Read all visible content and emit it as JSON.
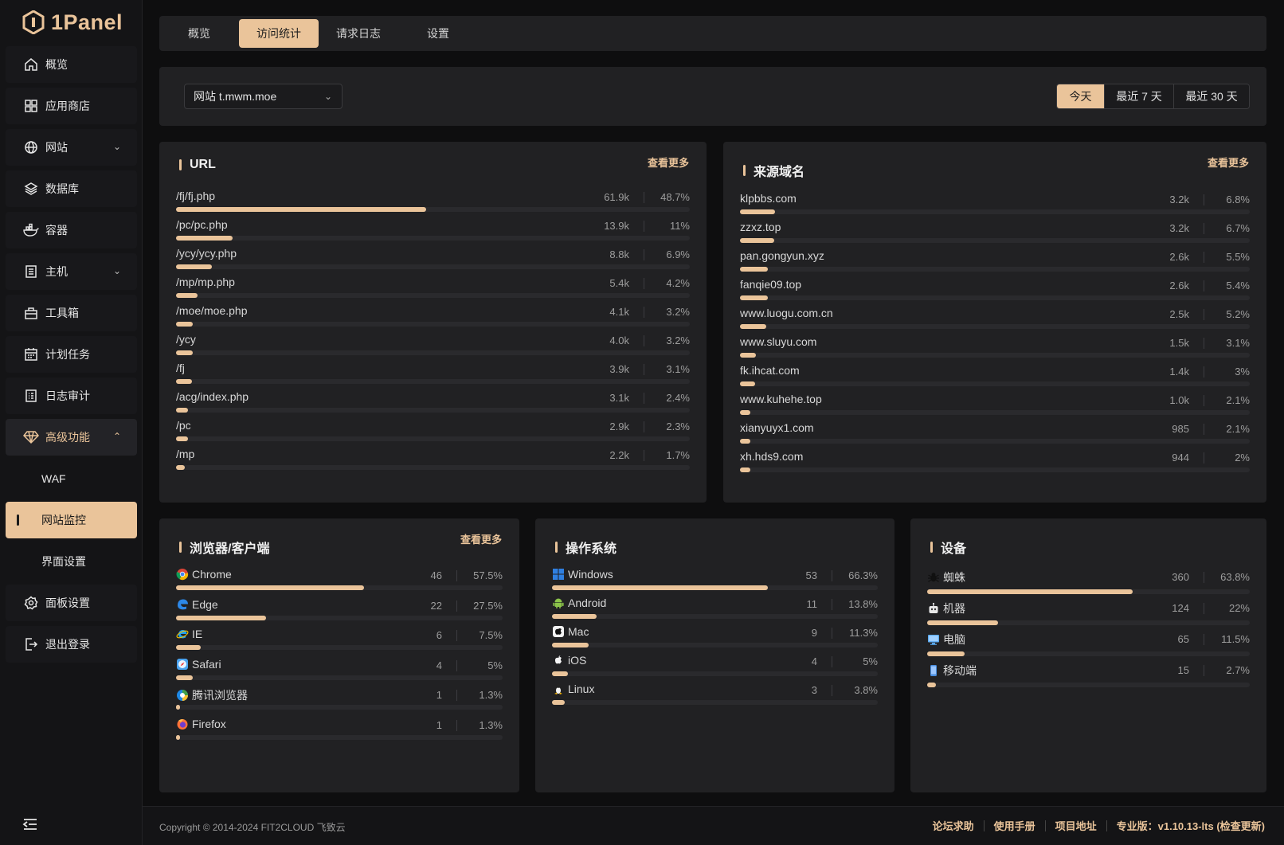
{
  "app": {
    "logo_text": "1Panel"
  },
  "sidebar": {
    "items": [
      {
        "label": "概览",
        "icon": "home-icon"
      },
      {
        "label": "应用商店",
        "icon": "apps-icon"
      },
      {
        "label": "网站",
        "icon": "globe-icon"
      },
      {
        "label": "数据库",
        "icon": "layers-icon"
      },
      {
        "label": "容器",
        "icon": "docker-icon"
      },
      {
        "label": "主机",
        "icon": "host-icon"
      },
      {
        "label": "工具箱",
        "icon": "toolbox-icon"
      },
      {
        "label": "计划任务",
        "icon": "calendar-icon"
      },
      {
        "label": "日志审计",
        "icon": "log-icon"
      },
      {
        "label": "高级功能",
        "icon": "diamond-icon"
      },
      {
        "label": "WAF"
      },
      {
        "label": "网站监控"
      },
      {
        "label": "界面设置"
      },
      {
        "label": "面板设置",
        "icon": "gear-icon"
      },
      {
        "label": "退出登录",
        "icon": "logout-icon"
      }
    ]
  },
  "tabs": [
    "概览",
    "访问统计",
    "请求日志",
    "设置"
  ],
  "filter": {
    "site": "网站 t.mwm.moe",
    "ranges": [
      "今天",
      "最近 7 天",
      "最近 30 天"
    ]
  },
  "more_label": "查看更多",
  "panels": {
    "url": {
      "title": "URL",
      "rows": [
        {
          "label": "/fj/fj.php",
          "count": "61.9k",
          "pct": "48.7%",
          "ratio": 0.487
        },
        {
          "label": "/pc/pc.php",
          "count": "13.9k",
          "pct": "11%",
          "ratio": 0.11
        },
        {
          "label": "/ycy/ycy.php",
          "count": "8.8k",
          "pct": "6.9%",
          "ratio": 0.069
        },
        {
          "label": "/mp/mp.php",
          "count": "5.4k",
          "pct": "4.2%",
          "ratio": 0.042
        },
        {
          "label": "/moe/moe.php",
          "count": "4.1k",
          "pct": "3.2%",
          "ratio": 0.032
        },
        {
          "label": "/ycy",
          "count": "4.0k",
          "pct": "3.2%",
          "ratio": 0.032
        },
        {
          "label": "/fj",
          "count": "3.9k",
          "pct": "3.1%",
          "ratio": 0.031
        },
        {
          "label": "/acg/index.php",
          "count": "3.1k",
          "pct": "2.4%",
          "ratio": 0.024
        },
        {
          "label": "/pc",
          "count": "2.9k",
          "pct": "2.3%",
          "ratio": 0.023
        },
        {
          "label": "/mp",
          "count": "2.2k",
          "pct": "1.7%",
          "ratio": 0.017
        }
      ]
    },
    "referer": {
      "title": "来源域名",
      "rows": [
        {
          "label": "klpbbs.com",
          "count": "3.2k",
          "pct": "6.8%",
          "ratio": 0.068
        },
        {
          "label": "zzxz.top",
          "count": "3.2k",
          "pct": "6.7%",
          "ratio": 0.067
        },
        {
          "label": "pan.gongyun.xyz",
          "count": "2.6k",
          "pct": "5.5%",
          "ratio": 0.055
        },
        {
          "label": "fanqie09.top",
          "count": "2.6k",
          "pct": "5.4%",
          "ratio": 0.054
        },
        {
          "label": "www.luogu.com.cn",
          "count": "2.5k",
          "pct": "5.2%",
          "ratio": 0.052
        },
        {
          "label": "www.sluyu.com",
          "count": "1.5k",
          "pct": "3.1%",
          "ratio": 0.031
        },
        {
          "label": "fk.ihcat.com",
          "count": "1.4k",
          "pct": "3%",
          "ratio": 0.03
        },
        {
          "label": "www.kuhehe.top",
          "count": "1.0k",
          "pct": "2.1%",
          "ratio": 0.021
        },
        {
          "label": "xianyuyx1.com",
          "count": "985",
          "pct": "2.1%",
          "ratio": 0.021
        },
        {
          "label": "xh.hds9.com",
          "count": "944",
          "pct": "2%",
          "ratio": 0.02
        }
      ]
    },
    "browser": {
      "title": "浏览器/客户端",
      "rows": [
        {
          "label": "Chrome",
          "count": "46",
          "pct": "57.5%",
          "ratio": 0.575,
          "icon": "chrome-icon"
        },
        {
          "label": "Edge",
          "count": "22",
          "pct": "27.5%",
          "ratio": 0.275,
          "icon": "edge-icon"
        },
        {
          "label": "IE",
          "count": "6",
          "pct": "7.5%",
          "ratio": 0.075,
          "icon": "ie-icon"
        },
        {
          "label": "Safari",
          "count": "4",
          "pct": "5%",
          "ratio": 0.05,
          "icon": "safari-icon"
        },
        {
          "label": "腾讯浏览器",
          "count": "1",
          "pct": "1.3%",
          "ratio": 0.013,
          "icon": "tencent-browser-icon"
        },
        {
          "label": "Firefox",
          "count": "1",
          "pct": "1.3%",
          "ratio": 0.013,
          "icon": "firefox-icon"
        }
      ]
    },
    "os": {
      "title": "操作系统",
      "rows": [
        {
          "label": "Windows",
          "count": "53",
          "pct": "66.3%",
          "ratio": 0.663,
          "icon": "windows-icon"
        },
        {
          "label": "Android",
          "count": "11",
          "pct": "13.8%",
          "ratio": 0.138,
          "icon": "android-icon"
        },
        {
          "label": "Mac",
          "count": "9",
          "pct": "11.3%",
          "ratio": 0.113,
          "icon": "mac-icon"
        },
        {
          "label": "iOS",
          "count": "4",
          "pct": "5%",
          "ratio": 0.05,
          "icon": "apple-icon"
        },
        {
          "label": "Linux",
          "count": "3",
          "pct": "3.8%",
          "ratio": 0.038,
          "icon": "linux-icon"
        }
      ]
    },
    "device": {
      "title": "设备",
      "rows": [
        {
          "label": "蜘蛛",
          "count": "360",
          "pct": "63.8%",
          "ratio": 0.638,
          "icon": "spider-icon"
        },
        {
          "label": "机器",
          "count": "124",
          "pct": "22%",
          "ratio": 0.22,
          "icon": "robot-icon"
        },
        {
          "label": "电脑",
          "count": "65",
          "pct": "11.5%",
          "ratio": 0.115,
          "icon": "desktop-icon"
        },
        {
          "label": "移动端",
          "count": "15",
          "pct": "2.7%",
          "ratio": 0.027,
          "icon": "mobile-icon"
        }
      ]
    }
  },
  "footer": {
    "copyright": "Copyright © 2014-2024 FIT2CLOUD 飞致云",
    "links": [
      "论坛求助",
      "使用手册",
      "项目地址",
      "专业版：",
      "v1.10.13-lts (检查更新)"
    ]
  },
  "colors": {
    "accent": "#eac49a",
    "background": "#0e0e0f",
    "card": "#212123"
  }
}
